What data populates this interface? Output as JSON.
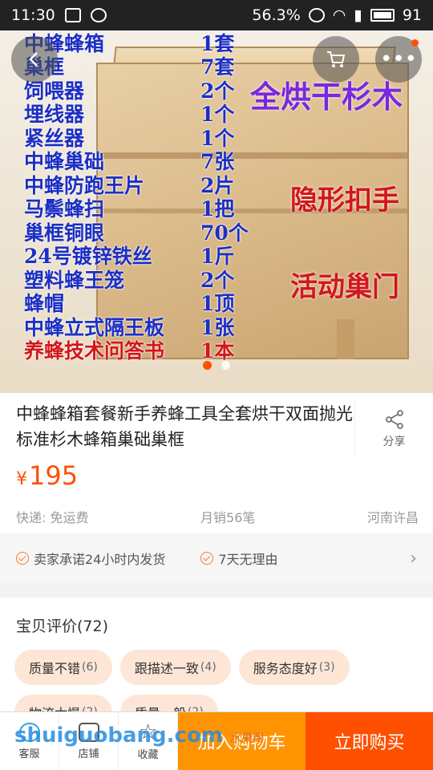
{
  "status_bar": {
    "time": "11:30",
    "battery_text": "56.3%",
    "battery_level": "91"
  },
  "hero": {
    "items": [
      {
        "name": "中蜂蜂箱",
        "qty": "1套"
      },
      {
        "name": "巢框",
        "qty": "7套"
      },
      {
        "name": "饲喂器",
        "qty": "2个"
      },
      {
        "name": "埋线器",
        "qty": "1个"
      },
      {
        "name": "紧丝器",
        "qty": "1个"
      },
      {
        "name": "中蜂巢础",
        "qty": "7张"
      },
      {
        "name": "中蜂防跑王片",
        "qty": "2片"
      },
      {
        "name": "马鬃蜂扫",
        "qty": "1把"
      },
      {
        "name": "巢框铜眼",
        "qty": "70个"
      },
      {
        "name": "24号镀锌铁丝",
        "qty": "1斤"
      },
      {
        "name": "塑料蜂王笼",
        "qty": "2个"
      },
      {
        "name": "蜂帽",
        "qty": "1顶"
      },
      {
        "name": "中蜂立式隔王板",
        "qty": "1张"
      },
      {
        "name": "养蜂技术问答书",
        "qty": "1本"
      }
    ],
    "tag_top": "全烘干杉木",
    "tag_mid": "隐形扣手",
    "tag_low": "活动巢门",
    "slide_count": 2,
    "active_slide": 0
  },
  "nav": {
    "back_icon": "back-icon",
    "cart_icon": "cart-icon",
    "more_icon": "more-icon"
  },
  "product": {
    "title": "中蜂蜂箱套餐新手养蜂工具全套烘干双面抛光标准杉木蜂箱巢础巢框",
    "share_label": "分享",
    "currency": "¥",
    "price": "195",
    "shipping": "快递: 免运费",
    "monthly_sales": "月销56笔",
    "location": "河南许昌"
  },
  "promises": [
    {
      "label": "卖家承诺24小时内发货"
    },
    {
      "label": "7天无理由"
    }
  ],
  "reviews": {
    "title": "宝贝评价(72)",
    "chips": [
      {
        "label": "质量不错",
        "count": "(6)"
      },
      {
        "label": "跟描述一致",
        "count": "(4)"
      },
      {
        "label": "服务态度好",
        "count": "(3)"
      },
      {
        "label": "物流太慢",
        "count": "(2)"
      },
      {
        "label": "质量一般",
        "count": "(2)"
      }
    ]
  },
  "bottom_bar": {
    "service": "客服",
    "shop": "店铺",
    "favorite": "收藏",
    "add_to_cart": "加入购物车",
    "buy_now": "立即购买"
  },
  "watermark": {
    "text": "shuiguobang.com",
    "cn": "水果帮"
  },
  "colors": {
    "accent": "#ff5000",
    "cart": "#ff9402",
    "list_blue": "#1c2fc4",
    "list_red": "#d2161c"
  }
}
